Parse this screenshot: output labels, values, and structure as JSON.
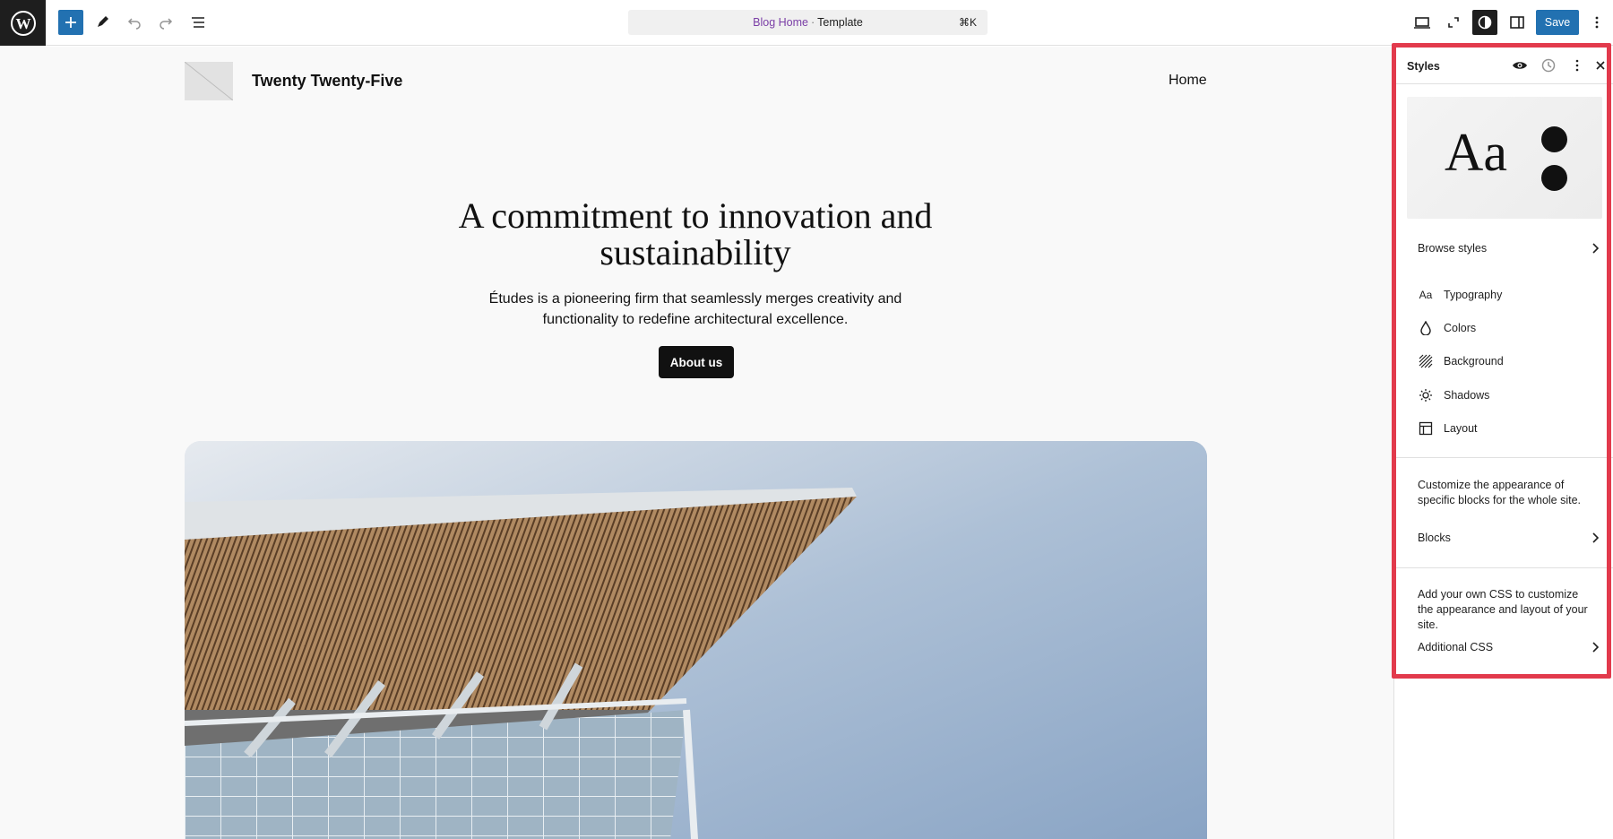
{
  "toolbar": {
    "document_title": "Blog Home",
    "document_type": "Template",
    "separator": "·",
    "shortcut": "⌘K",
    "save_label": "Save",
    "accent_color": "#2271b1"
  },
  "site": {
    "title": "Twenty Twenty-Five",
    "nav_home": "Home",
    "hero_title": "A commitment to innovation and sustainability",
    "hero_description": "Études is a pioneering firm that seamlessly merges creativity and functionality to redefine architectural excellence.",
    "hero_button": "About us"
  },
  "sidebar": {
    "title": "Styles",
    "preview_text": "Aa",
    "browse_styles": "Browse styles",
    "items": [
      {
        "label": "Typography",
        "icon": "typography-icon"
      },
      {
        "label": "Colors",
        "icon": "droplet-icon"
      },
      {
        "label": "Background",
        "icon": "background-icon"
      },
      {
        "label": "Shadows",
        "icon": "shadow-icon"
      },
      {
        "label": "Layout",
        "icon": "layout-icon"
      }
    ],
    "blocks_description": "Customize the appearance of specific blocks for the whole site.",
    "blocks_label": "Blocks",
    "css_description": "Add your own CSS to customize the appearance and layout of your site.",
    "css_label": "Additional CSS",
    "highlight_color": "#e23a4c"
  }
}
